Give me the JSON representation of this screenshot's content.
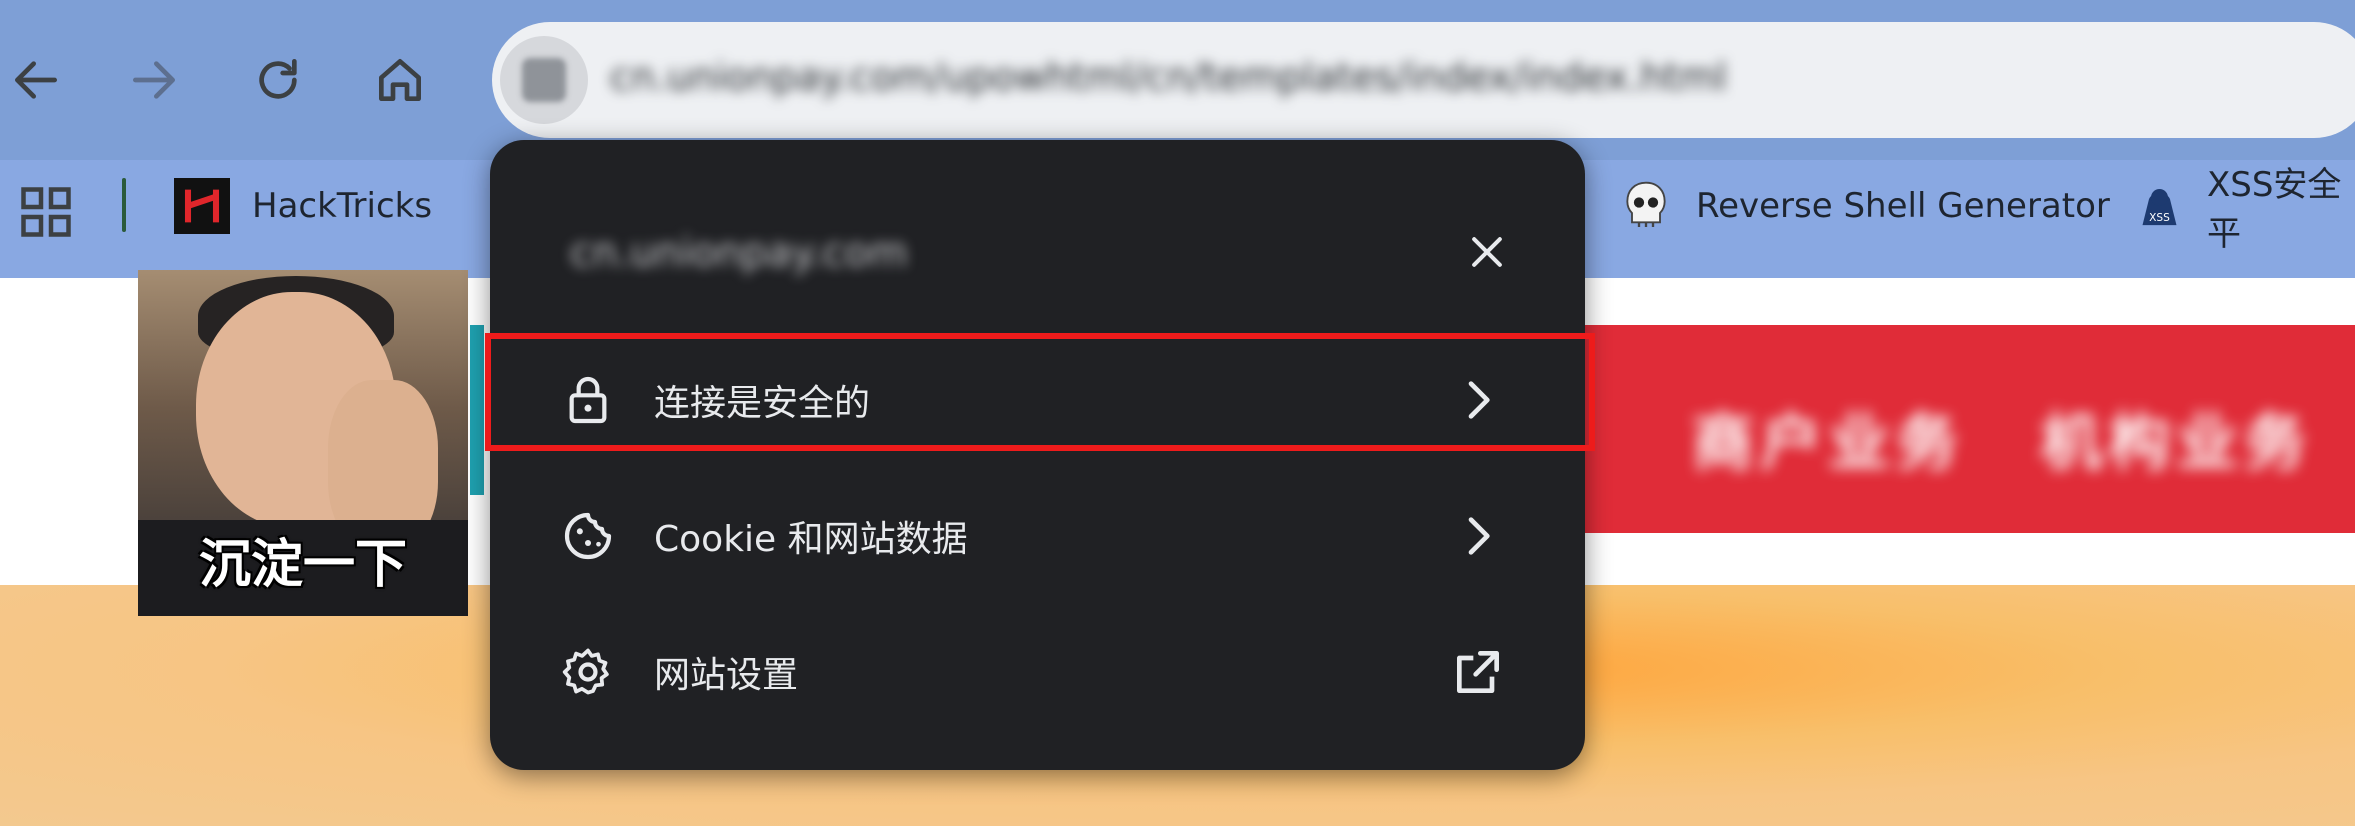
{
  "browser": {
    "url": "cn.unionpay.com/upowhtml/cn/templates/index/index.html"
  },
  "bookmarks": [
    {
      "label": "HackTricks",
      "icon": "hacktricks-icon"
    },
    {
      "label": "Reverse Shell Generator",
      "icon": "skull-icon"
    },
    {
      "label": "XSS安全平",
      "icon": "xss-icon"
    }
  ],
  "page": {
    "banner_items": [
      "商户业务",
      "机构业务"
    ],
    "sticker_caption": "沉淀一下"
  },
  "site_info_popup": {
    "domain": "cn.unionpay.com",
    "rows": [
      {
        "label": "连接是安全的",
        "icon": "lock-icon",
        "trail": "chevron-right-icon"
      },
      {
        "label": "Cookie 和网站数据",
        "icon": "cookie-icon",
        "trail": "chevron-right-icon"
      },
      {
        "label": "网站设置",
        "icon": "gear-icon",
        "trail": "external-link-icon"
      }
    ]
  },
  "annotation": {
    "color": "#ee1b1b"
  }
}
